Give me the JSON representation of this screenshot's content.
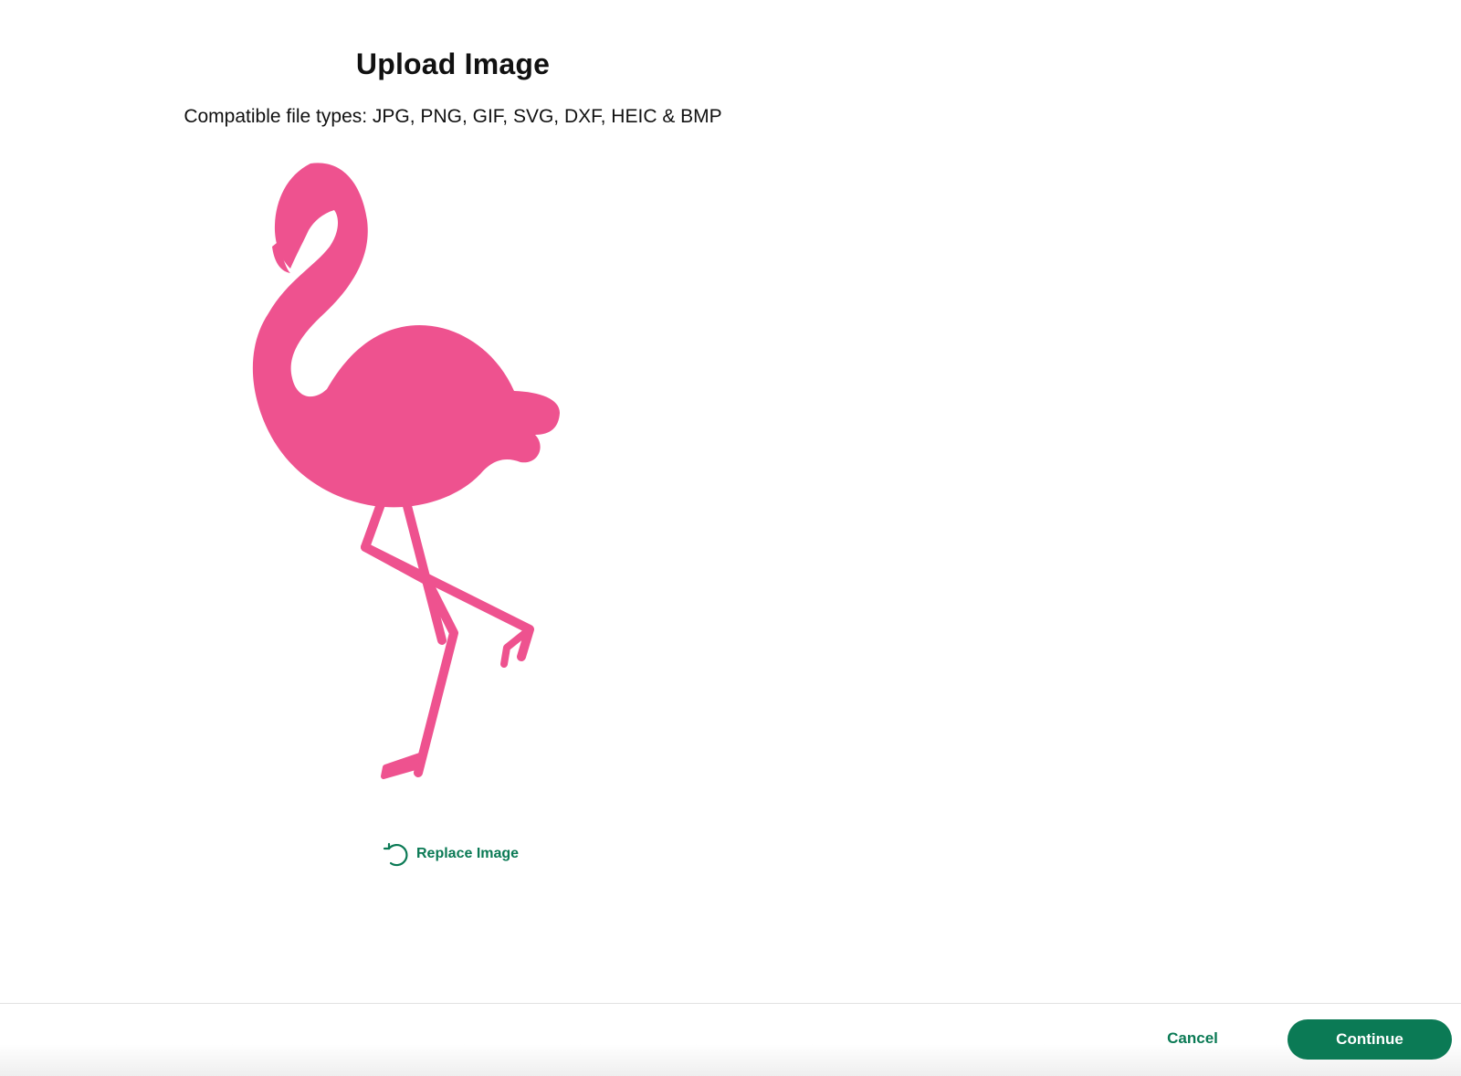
{
  "dialog": {
    "title": "Upload Image",
    "subtitle": "Compatible file types:  JPG, PNG, GIF, SVG, DXF, HEIC & BMP"
  },
  "preview": {
    "image_description": "flamingo-silhouette",
    "fill_color": "#ee528f"
  },
  "actions": {
    "replace_label": "Replace Image",
    "replace_icon": "replace-icon",
    "cancel_label": "Cancel",
    "continue_label": "Continue",
    "accent_color": "#0b7a55"
  }
}
